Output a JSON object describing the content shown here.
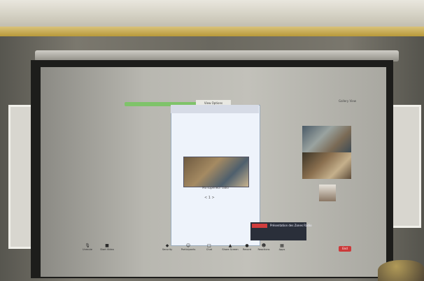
{
  "zoom": {
    "view_option": "View Options",
    "gallery_view": "Gallery View",
    "phone_caption": "Ma supérieur radio",
    "phone_nav": "< 1 >",
    "participant_name": "",
    "toast": {
      "tag": "",
      "title": "Présentation des Zones Radio"
    },
    "toolbar": [
      {
        "label": "Unmute",
        "icon": "mic"
      },
      {
        "label": "Start Video",
        "icon": "video"
      },
      {
        "label": "Security",
        "icon": "shield"
      },
      {
        "label": "Participants",
        "icon": "people"
      },
      {
        "label": "Chat",
        "icon": "chat"
      },
      {
        "label": "Share Screen",
        "icon": "share"
      },
      {
        "label": "Record",
        "icon": "record"
      },
      {
        "label": "Reactions",
        "icon": "smile"
      },
      {
        "label": "Apps",
        "icon": "apps"
      }
    ],
    "end_label": "End"
  },
  "colors": {
    "recording_bar": "#7fc36a",
    "end_button": "#cc3a3a",
    "toast_tag": "#d13d3d"
  }
}
